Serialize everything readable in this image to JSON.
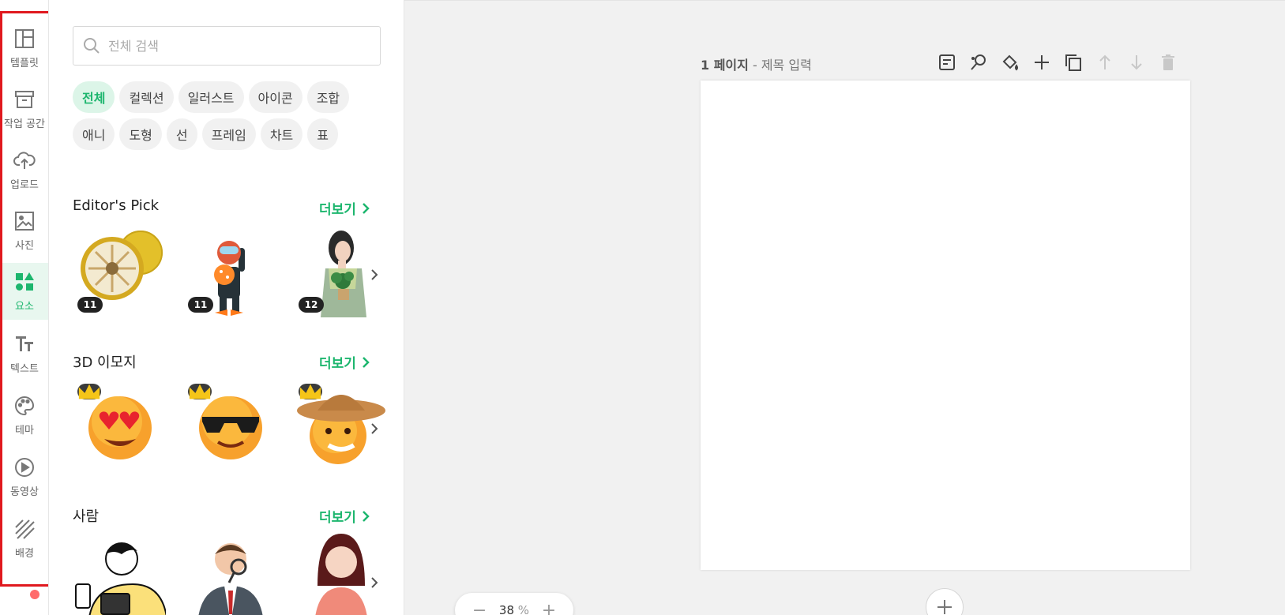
{
  "sidebar": {
    "items": [
      {
        "label": "템플릿",
        "icon": "template-icon"
      },
      {
        "label": "작업 공간",
        "icon": "archive-icon"
      },
      {
        "label": "업로드",
        "icon": "upload-cloud-icon"
      },
      {
        "label": "사진",
        "icon": "photo-icon"
      },
      {
        "label": "요소",
        "icon": "elements-icon",
        "active": true
      },
      {
        "label": "텍스트",
        "icon": "text-icon"
      },
      {
        "label": "테마",
        "icon": "palette-icon"
      },
      {
        "label": "동영상",
        "icon": "play-icon"
      },
      {
        "label": "배경",
        "icon": "background-icon"
      }
    ]
  },
  "panel": {
    "search_placeholder": "전체 검색",
    "chips_row1": [
      "전체",
      "컬렉션",
      "일러스트",
      "아이콘",
      "조합"
    ],
    "chips_row2": [
      "애니",
      "도형",
      "선",
      "프레임",
      "차트",
      "표"
    ],
    "active_chip": "전체",
    "sections": [
      {
        "title": "Editor's Pick",
        "more": "더보기",
        "badges": [
          "11",
          "11",
          "12"
        ]
      },
      {
        "title": "3D 이모지",
        "more": "더보기"
      },
      {
        "title": "사람",
        "more": "더보기"
      }
    ]
  },
  "canvas": {
    "page_number": "1 페이지",
    "page_separator": " - ",
    "page_title_placeholder": "제목 입력",
    "zoom": "38",
    "zoom_unit": "%"
  },
  "colors": {
    "accent": "#1db66e",
    "accent_bg": "#e8f7ef",
    "highlight": "#e0191f"
  }
}
